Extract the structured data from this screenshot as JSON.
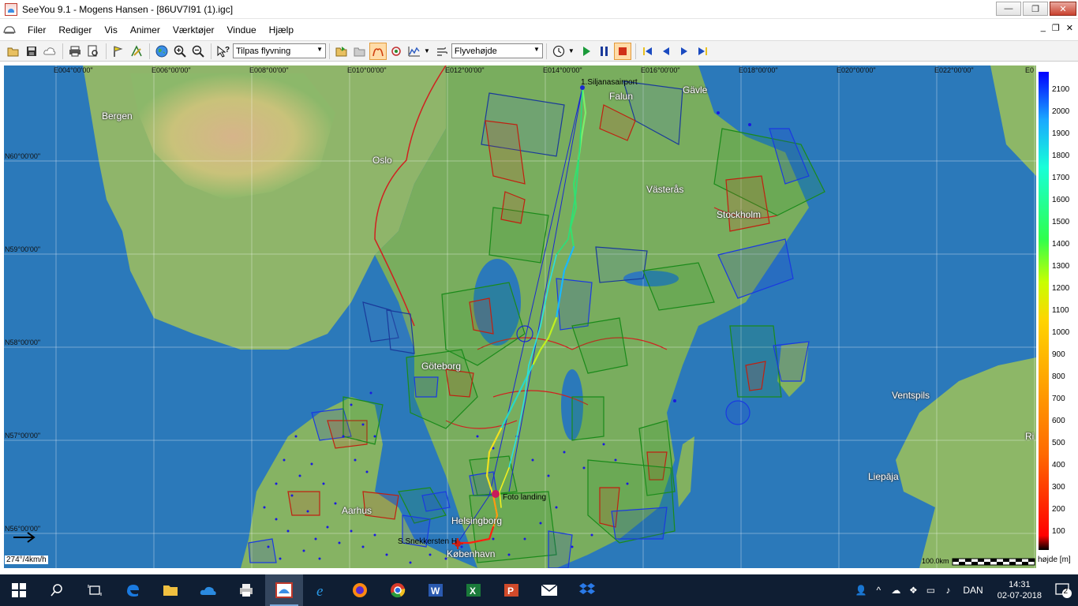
{
  "window": {
    "title": "SeeYou 9.1 - Mogens Hansen - [86UV7I91 (1).igc]",
    "minimize": "—",
    "restore": "❐",
    "close": "✕"
  },
  "menu": {
    "items": [
      "Filer",
      "Rediger",
      "Vis",
      "Animer",
      "Værktøjer",
      "Vindue",
      "Hjælp"
    ],
    "mdi_minimize": "_",
    "mdi_restore": "❐",
    "mdi_close": "✕"
  },
  "toolbar": {
    "view_select": "Tilpas flyvning",
    "mode_select": "Flyvehøjde"
  },
  "map": {
    "longitudes": [
      "E004°00'00\"",
      "E006°00'00\"",
      "E008°00'00\"",
      "E010°00'00\"",
      "E012°00'00\"",
      "E014°00'00\"",
      "E016°00'00\"",
      "E018°00'00\"",
      "E020°00'00\"",
      "E022°00'00\"",
      "E0"
    ],
    "latitudes": [
      "N60°00'00\"",
      "N59°00'00\"",
      "N58°00'00\"",
      "N57°00'00\"",
      "N56°00'00\""
    ],
    "cities": [
      "Bergen",
      "Oslo",
      "Falun",
      "Gävle",
      "Västerås",
      "Stockholm",
      "Göteborg",
      "Ventspils",
      "Liepāja",
      "Aarhus",
      "Helsingborg",
      "København",
      "Ri"
    ],
    "waypoints": {
      "start": "1.Siljanasairport",
      "landing": "Foto landing",
      "finish": "S.Snekkersten H"
    },
    "wind": "274°/4km/h",
    "scale": "100.0km"
  },
  "legend": {
    "ticks": [
      "2100",
      "2000",
      "1900",
      "1800",
      "1700",
      "1600",
      "1500",
      "1400",
      "1300",
      "1200",
      "1100",
      "1000",
      "900",
      "800",
      "700",
      "600",
      "500",
      "400",
      "300",
      "200",
      "100"
    ],
    "title": "højde [m]"
  },
  "taskbar": {
    "language": "DAN",
    "time": "14:31",
    "date": "02-07-2018",
    "notifications": "2"
  }
}
